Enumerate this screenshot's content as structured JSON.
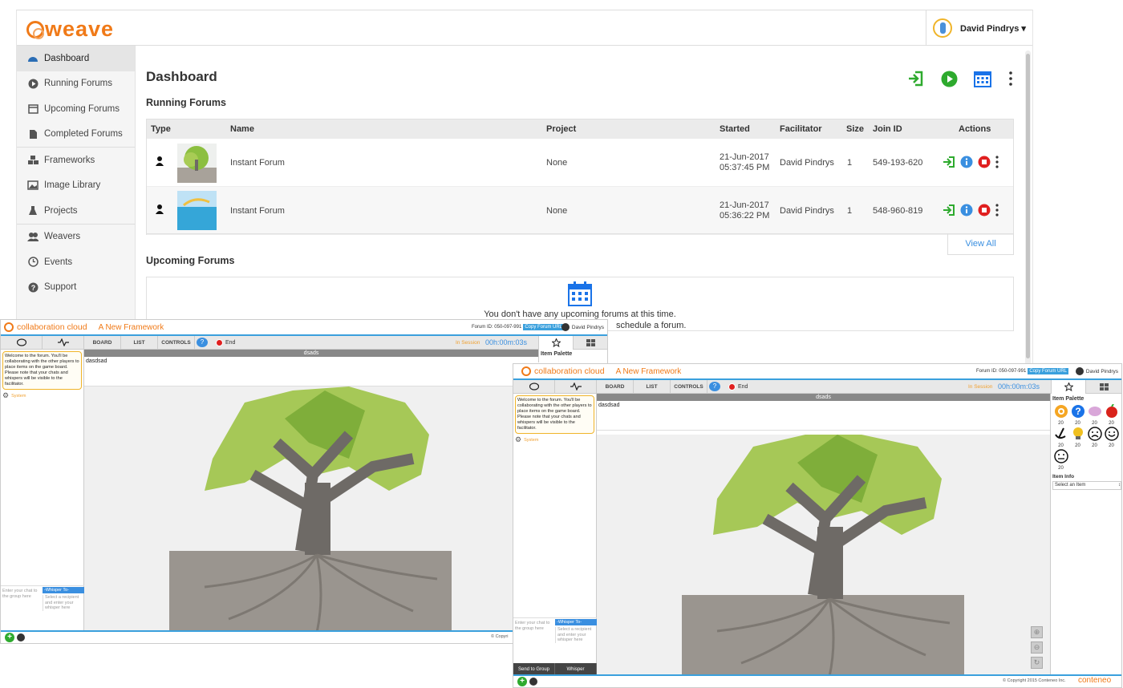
{
  "app": {
    "logo": "weave"
  },
  "user": {
    "name": "David Pindrys ▾"
  },
  "sidebar": {
    "items": [
      {
        "label": "Dashboard"
      },
      {
        "label": "Running Forums"
      },
      {
        "label": "Upcoming Forums"
      },
      {
        "label": "Completed Forums"
      },
      {
        "label": "Frameworks"
      },
      {
        "label": "Image Library"
      },
      {
        "label": "Projects"
      },
      {
        "label": "Weavers"
      },
      {
        "label": "Events"
      },
      {
        "label": "Support"
      }
    ]
  },
  "main": {
    "title": "Dashboard",
    "running_title": "Running Forums",
    "upcoming_title": "Upcoming Forums",
    "view_all": "View All",
    "empty_msg": "You don't have any upcoming forums at this time.",
    "empty_msg2": "schedule a forum."
  },
  "table": {
    "headers": {
      "type": "Type",
      "name": "Name",
      "project": "Project",
      "started": "Started",
      "facilitator": "Facilitator",
      "size": "Size",
      "join": "Join ID",
      "actions": "Actions"
    },
    "rows": [
      {
        "name": "Instant Forum",
        "project": "None",
        "date": "21-Jun-2017",
        "time": "05:37:45 PM",
        "facilitator": "David Pindrys",
        "size": "1",
        "join": "549-193-620"
      },
      {
        "name": "Instant Forum",
        "project": "None",
        "date": "21-Jun-2017",
        "time": "05:36:22 PM",
        "facilitator": "David Pindrys",
        "size": "1",
        "join": "548-960-819"
      }
    ]
  },
  "forum": {
    "brand": "collaboration cloud",
    "framework": "A New Framework",
    "forum_id": "Forum ID: 050-097-991",
    "copy_url": "Copy Forum URL",
    "user": "David Pindrys",
    "tab_board": "BOARD",
    "tab_list": "LIST",
    "tab_controls": "CONTROLS",
    "end": "End",
    "in_session": "In Session",
    "timer": "00h:00m:03s",
    "board_name": "dsads",
    "notes": "dasdsad",
    "welcome": "Welcome to the forum. You'll be collaborating with the other players to place items on the game board. Please note that your chats and whispers will be visible to the facilitator.",
    "system": "System",
    "chat_placeholder": "Enter your chat to the group here",
    "whisper_to": "-Whisper To-",
    "whisper_placeholder": "Select a recipient and enter your whisper here",
    "send_group": "Send to Group",
    "whisper": "Whisper",
    "item_palette": "Item Palette",
    "item_info": "Item Info",
    "select_item": "Select an Item",
    "copyright": "© Copyright 2015 Conteneo Inc.",
    "copyright_short": "© Copyri",
    "conteneo": "conteneo",
    "palette_counts": [
      "20",
      "20",
      "20",
      "20",
      "20",
      "20",
      "20",
      "20",
      "20"
    ]
  }
}
